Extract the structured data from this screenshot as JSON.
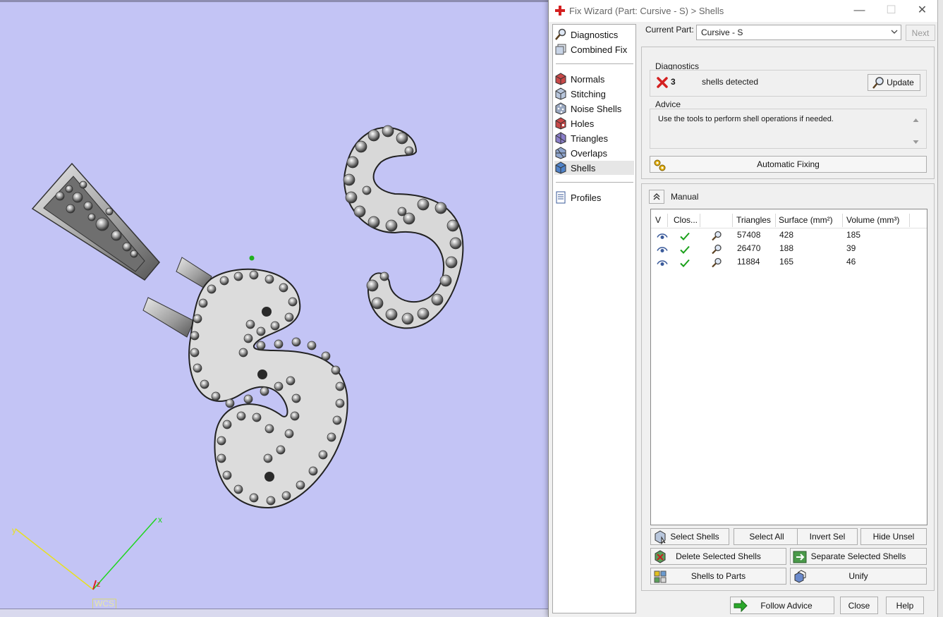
{
  "viewport": {
    "axis_x_label": "x",
    "axis_y_label": "y",
    "axis_z_label": "z",
    "wcs_label": "WCS"
  },
  "dialog": {
    "title": "Fix Wizard (Part: Cursive - S) > Shells",
    "window_controls": {
      "minimize": "—",
      "maximize": "☐",
      "close": "✕"
    },
    "nav": {
      "items_top": [
        {
          "label": "Diagnostics",
          "icon": "magnifier-icon"
        },
        {
          "label": "Combined Fix",
          "icon": "layers-icon"
        }
      ],
      "items_mid": [
        {
          "label": "Normals",
          "icon": "normals-cube-icon"
        },
        {
          "label": "Stitching",
          "icon": "stitching-icon"
        },
        {
          "label": "Noise Shells",
          "icon": "noise-dice-icon"
        },
        {
          "label": "Holes",
          "icon": "holes-cube-icon"
        },
        {
          "label": "Triangles",
          "icon": "triangles-icon"
        },
        {
          "label": "Overlaps",
          "icon": "overlaps-icon"
        },
        {
          "label": "Shells",
          "icon": "shells-cube-icon",
          "selected": true
        }
      ],
      "items_bottom": [
        {
          "label": "Profiles",
          "icon": "document-icon"
        }
      ]
    },
    "current_part_label": "Current Part:",
    "current_part_value": "Cursive - S",
    "next_button": "Next",
    "diagnostics": {
      "heading": "Diagnostics",
      "count": "3",
      "message": "shells detected",
      "update_button": "Update"
    },
    "advice": {
      "heading": "Advice",
      "text": "Use the tools to perform shell operations if needed."
    },
    "automatic_fixing_button": "Automatic Fixing",
    "manual": {
      "heading": "Manual",
      "columns": [
        "V",
        "Clos...",
        "",
        "Triangles",
        "Surface (mm²)",
        "Volume (mm³)"
      ],
      "rows": [
        {
          "triangles": "57408",
          "surface": "428",
          "volume": "185"
        },
        {
          "triangles": "26470",
          "surface": "188",
          "volume": "39"
        },
        {
          "triangles": "11884",
          "surface": "165",
          "volume": "46"
        }
      ],
      "buttons": {
        "select_shells": "Select Shells",
        "select_all": "Select All",
        "invert_sel": "Invert Sel",
        "hide_unsel": "Hide Unsel",
        "delete_selected": "Delete Selected Shells",
        "separate_selected": "Separate Selected Shells",
        "shells_to_parts": "Shells to Parts",
        "unify": "Unify"
      }
    },
    "footer": {
      "follow_advice": "Follow Advice",
      "close": "Close",
      "help": "Help"
    }
  },
  "colors": {
    "viewport_bg": "#c3c4f5",
    "dialog_bg": "#f0f0f0",
    "axis_x": "#1fd61f",
    "axis_y": "#e8e020",
    "axis_z": "#e02020",
    "check_green": "#1aa01a",
    "error_red": "#d42020"
  }
}
